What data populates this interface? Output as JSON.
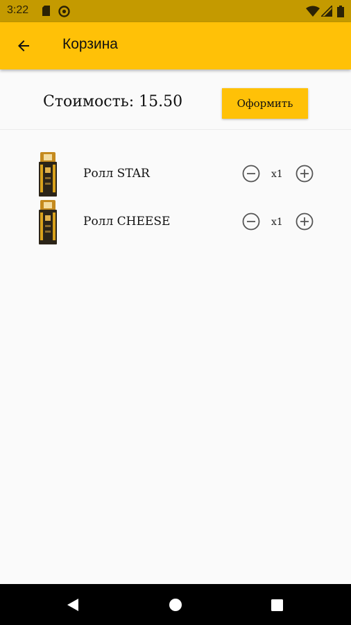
{
  "status_bar": {
    "time": "3:22",
    "left_icons": [
      "sim-card-icon",
      "do-not-disturb-icon"
    ],
    "right_icons": [
      "wifi-icon",
      "signal-icon",
      "battery-icon"
    ]
  },
  "app_bar": {
    "back_icon": "arrow-left-icon",
    "title": "Корзина",
    "background": "#ffc107"
  },
  "summary": {
    "total_text": "Стоимость: 15.50",
    "checkout_label": "Оформить"
  },
  "cart": {
    "items": [
      {
        "name": "Ролл STAR",
        "quantity": "x1"
      },
      {
        "name": "Ролл CHEESE",
        "quantity": "x1"
      }
    ]
  },
  "nav_bar": {
    "buttons": [
      "back-triangle-icon",
      "home-circle-icon",
      "recents-square-icon"
    ]
  }
}
